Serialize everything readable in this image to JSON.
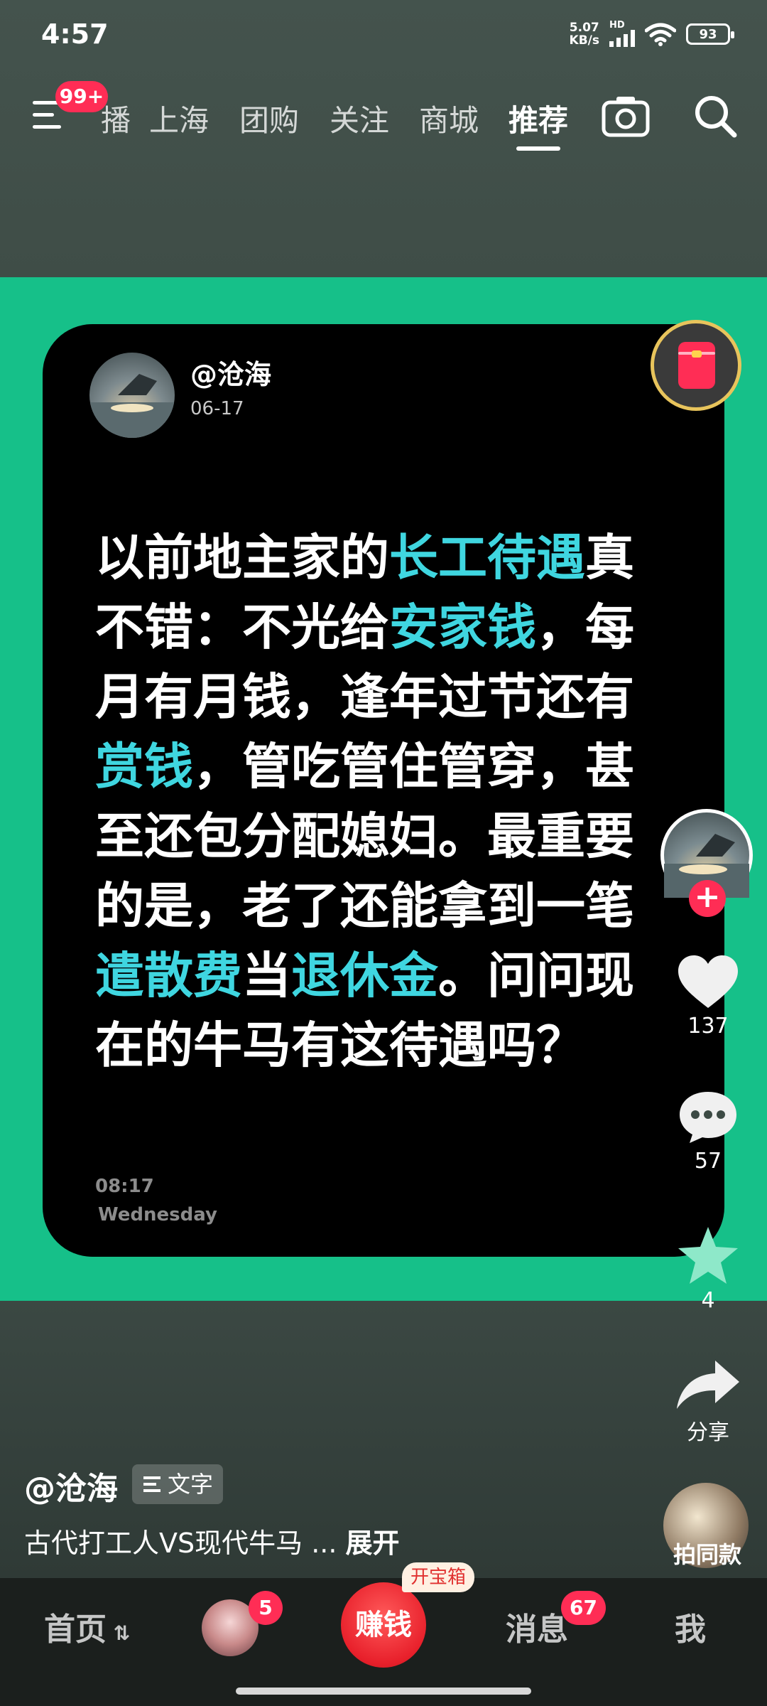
{
  "status_bar": {
    "time": "4:57",
    "net_speed_value": "5.07",
    "net_speed_unit": "KB/s",
    "network_label": "HD",
    "battery": "93"
  },
  "top_nav": {
    "menu_badge": "99+",
    "tabs": [
      {
        "label": "播"
      },
      {
        "label": "上海"
      },
      {
        "label": "团购"
      },
      {
        "label": "关注"
      },
      {
        "label": "商城"
      },
      {
        "label": "推荐"
      }
    ],
    "active_tab": "推荐"
  },
  "post": {
    "author": "@沧海",
    "date": "06-17",
    "segments": [
      {
        "text": "以前地主家的",
        "hl": false
      },
      {
        "text": "长工待遇",
        "hl": true
      },
      {
        "text": "真不错：不光给",
        "hl": false
      },
      {
        "text": "安家钱",
        "hl": true
      },
      {
        "text": "，每月有月钱，逢年过节还有",
        "hl": false
      },
      {
        "text": "赏钱",
        "hl": true
      },
      {
        "text": "，管吃管住管穿，甚至还包分配媳妇。最重要的是，老了还能拿到一笔",
        "hl": false
      },
      {
        "text": "遣散费",
        "hl": true
      },
      {
        "text": "当",
        "hl": false
      },
      {
        "text": "退休金",
        "hl": true
      },
      {
        "text": "。问问现在的牛马有这待遇吗？",
        "hl": false
      }
    ],
    "card_time": "08:17",
    "card_day": "Wednesday"
  },
  "right_rail": {
    "like_count": "137",
    "comment_count": "57",
    "favorite_count": "4",
    "share_label": "分享",
    "same_style_label": "拍同款"
  },
  "bottom_info": {
    "handle": "@沧海",
    "tag_label": "文字",
    "caption": "古代打工人VS现代牛马 ...",
    "expand_label": "展开"
  },
  "bottom_nav": {
    "home_label": "首页",
    "friends_badge": "5",
    "earn_label": "赚钱",
    "treasure_label": "开宝箱",
    "messages_label": "消息",
    "messages_badge": "67",
    "me_label": "我"
  },
  "colors": {
    "highlight": "#3fd6e0",
    "green_band": "#16c089",
    "badge_red": "#ff2d55"
  }
}
